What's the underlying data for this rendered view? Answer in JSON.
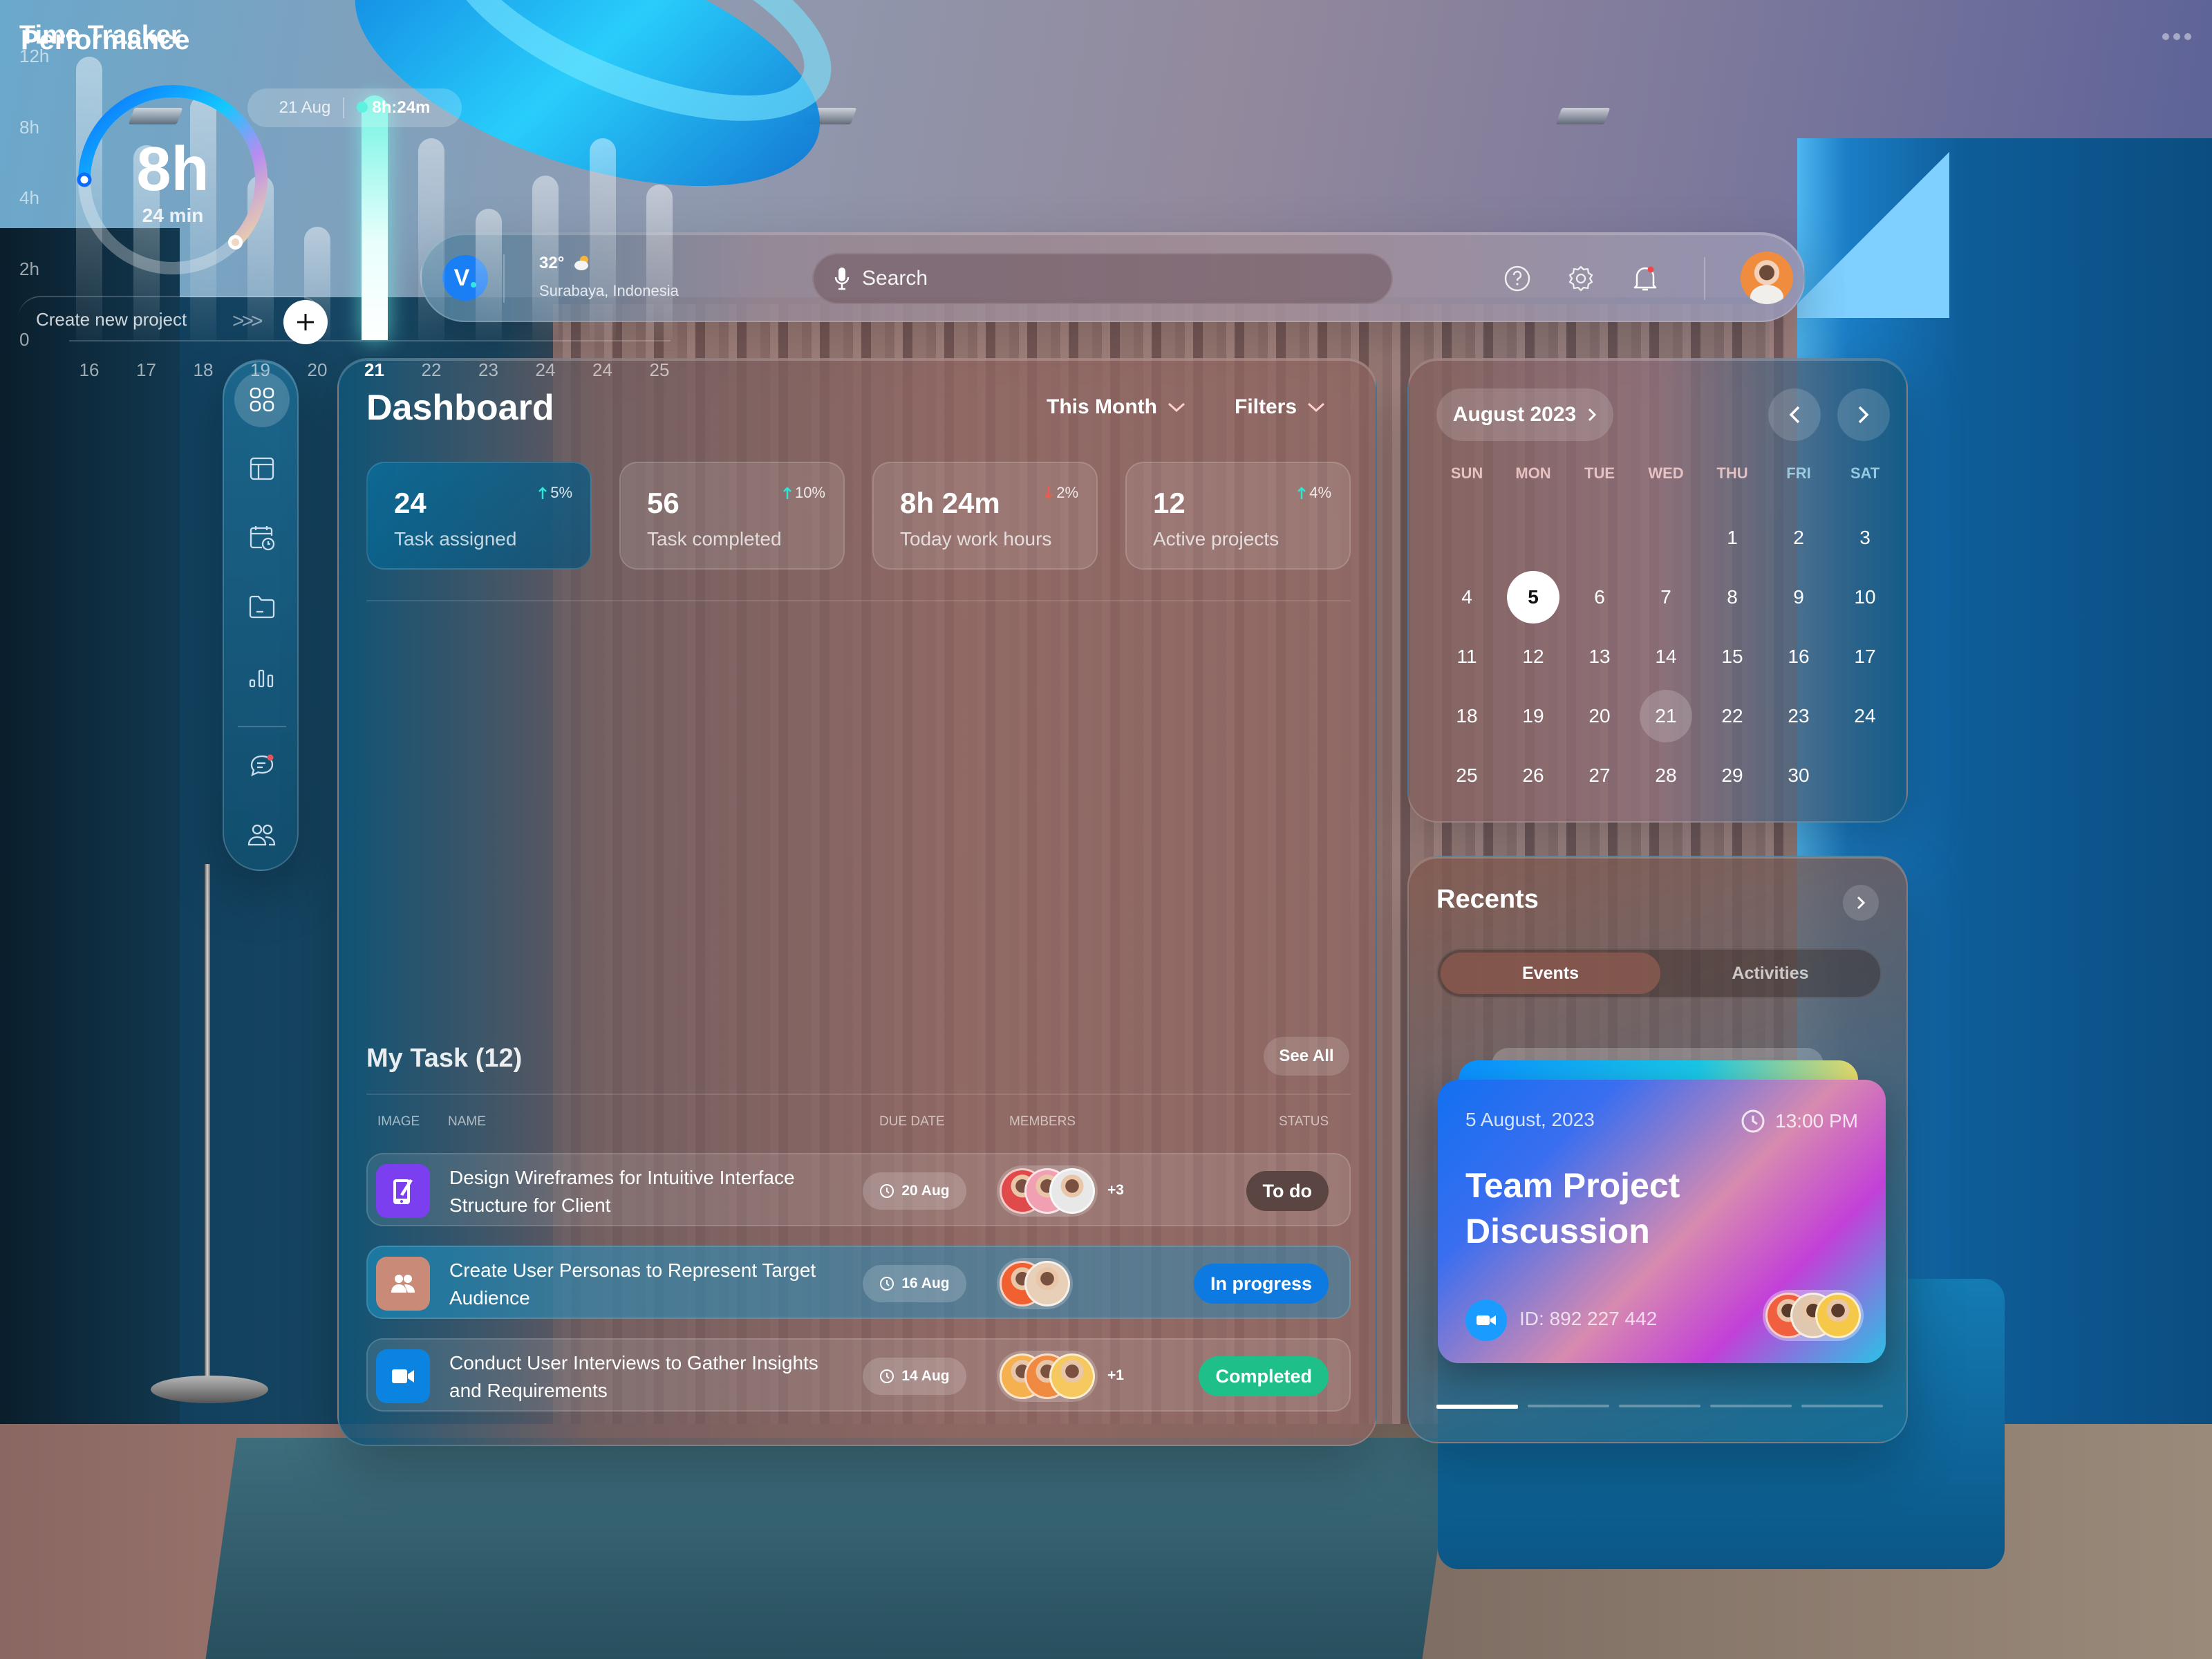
{
  "topbar": {
    "logo_letter": "V",
    "weather": {
      "temp": "32°",
      "icon": "partly-cloudy-icon",
      "location": "Surabaya, Indonesia"
    },
    "search": {
      "placeholder": "Search",
      "icon": "microphone-icon"
    },
    "icons": [
      "help-icon",
      "settings-icon",
      "notification-bell-icon"
    ],
    "notification_dot": true
  },
  "sidebar": {
    "items": [
      {
        "icon": "grid-icon",
        "label": "Dashboard",
        "active": true
      },
      {
        "icon": "layout-icon",
        "label": "Layout"
      },
      {
        "icon": "calendar-clock-icon",
        "label": "Schedule"
      },
      {
        "icon": "folder-icon",
        "label": "Files"
      },
      {
        "icon": "bar-chart-icon",
        "label": "Analytics"
      },
      {
        "icon": "chat-icon",
        "label": "Messages",
        "badge": true
      },
      {
        "icon": "users-icon",
        "label": "Team"
      }
    ]
  },
  "dashboard": {
    "title": "Dashboard",
    "period_filter": "This Month",
    "filters_label": "Filters",
    "stats": [
      {
        "value": "24",
        "label": "Task assigned",
        "delta": "5%",
        "trend": "up"
      },
      {
        "value": "56",
        "label": "Task completed",
        "delta": "10%",
        "trend": "up"
      },
      {
        "value": "8h 24m",
        "label": "Today work hours",
        "delta": "2%",
        "trend": "down"
      },
      {
        "value": "12",
        "label": "Active projects",
        "delta": "4%",
        "trend": "up"
      }
    ]
  },
  "performance": {
    "title": "Performance",
    "tooltip": {
      "date": "21 Aug",
      "value": "8h:24m"
    }
  },
  "chart_data": {
    "type": "bar",
    "title": "Performance",
    "categories": [
      "16",
      "17",
      "18",
      "19",
      "20",
      "21",
      "22",
      "23",
      "24",
      "24",
      "25"
    ],
    "values": [
      12,
      7.0,
      9.8,
      5.3,
      3.2,
      9.8,
      7.4,
      3.7,
      5.3,
      7.4,
      4.8
    ],
    "highlight_index": 5,
    "yticks": [
      "0",
      "2h",
      "4h",
      "8h",
      "12h"
    ],
    "ytick_values": [
      0,
      2,
      4,
      8,
      12
    ],
    "xlabel": "",
    "ylabel": "",
    "ylim": [
      0,
      12
    ],
    "grid": false
  },
  "time_tracker": {
    "title": "Time Tracker",
    "hours": "8h",
    "minutes": "24 min",
    "progress": 0.625,
    "create_label": "Create new project",
    "arrows": ">>>"
  },
  "tasks": {
    "title": "My Task (12)",
    "see_all": "See All",
    "columns": [
      "IMAGE",
      "NAME",
      "DUE DATE",
      "MEMBERS",
      "STATUS"
    ],
    "rows": [
      {
        "icon": "tablet-pen-icon",
        "icon_bg": "#7b3ff0",
        "name": "Design Wireframes for Intuitive Interface Structure for Client",
        "due": "20 Aug",
        "member_colors": [
          "#e04a4a",
          "#f0a0b0",
          "#e8e8e8"
        ],
        "extra_members": "+3",
        "status": "To do",
        "status_bg": "#5a4542"
      },
      {
        "icon": "users-icon",
        "icon_bg": "#c98a78",
        "name": "Create User Personas to Represent Target Audience",
        "due": "16 Aug",
        "member_colors": [
          "#f06030",
          "#e8d0b8"
        ],
        "extra_members": "",
        "status": "In progress",
        "status_bg": "#0c7ae0"
      },
      {
        "icon": "video-camera-icon",
        "icon_bg": "#0a84e0",
        "name": "Conduct User Interviews to Gather Insights and Requirements",
        "due": "14 Aug",
        "member_colors": [
          "#f5b050",
          "#f08a40",
          "#f5c860"
        ],
        "extra_members": "+1",
        "status": "Completed",
        "status_bg": "#1fbf8a"
      }
    ]
  },
  "calendar": {
    "month_label": "August 2023",
    "weekdays": [
      "SUN",
      "MON",
      "TUE",
      "WED",
      "THU",
      "FRI",
      "SAT"
    ],
    "first_weekday_index": 4,
    "days_in_month": 30,
    "today": 5,
    "selected": 21
  },
  "recents": {
    "title": "Recents",
    "tabs": [
      "Events",
      "Activities"
    ],
    "active_tab": 0,
    "event": {
      "date": "5 August, 2023",
      "time": "13:00 PM",
      "title": "Team Project Discussion",
      "meeting_id": "ID: 892 227 442",
      "member_colors": [
        "#f06040",
        "#e0c8b0",
        "#f5c84a"
      ]
    },
    "pages": 5,
    "active_page": 0
  }
}
